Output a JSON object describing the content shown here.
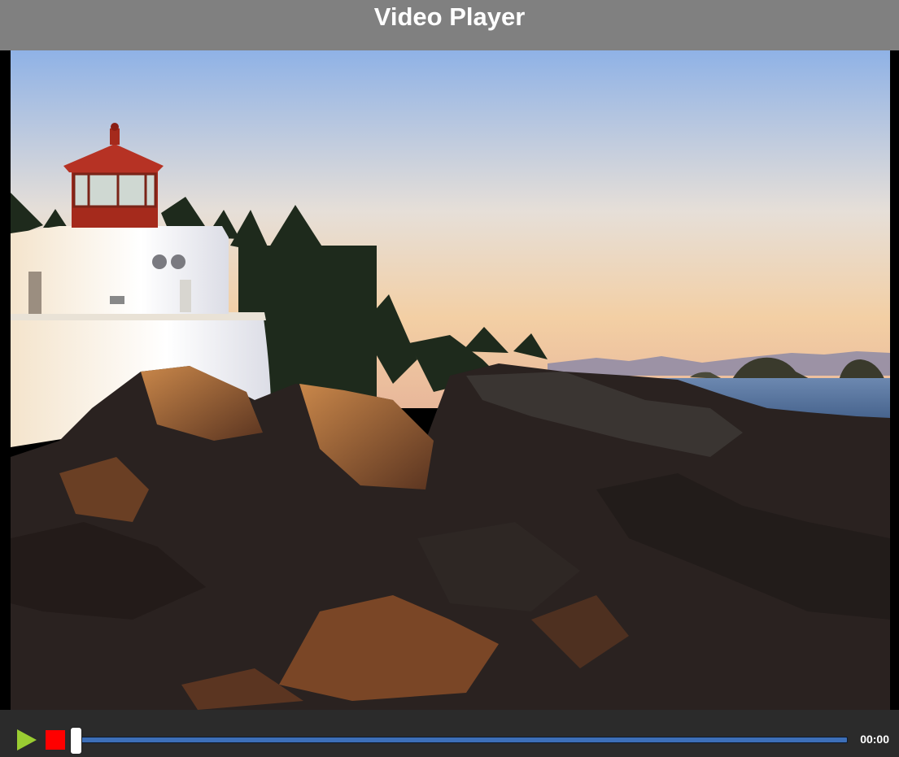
{
  "header": {
    "title": "Video Player"
  },
  "video": {
    "scene": "lighthouse-on-rocky-shore-at-sunset"
  },
  "controls": {
    "play_icon": "play-icon",
    "stop_icon": "stop-icon",
    "time_display": "00:00",
    "progress": 0,
    "colors": {
      "play": "#9acd32",
      "stop": "#ff0000",
      "track": "#3d6fb8",
      "bar_background": "#2b2b2b"
    }
  }
}
